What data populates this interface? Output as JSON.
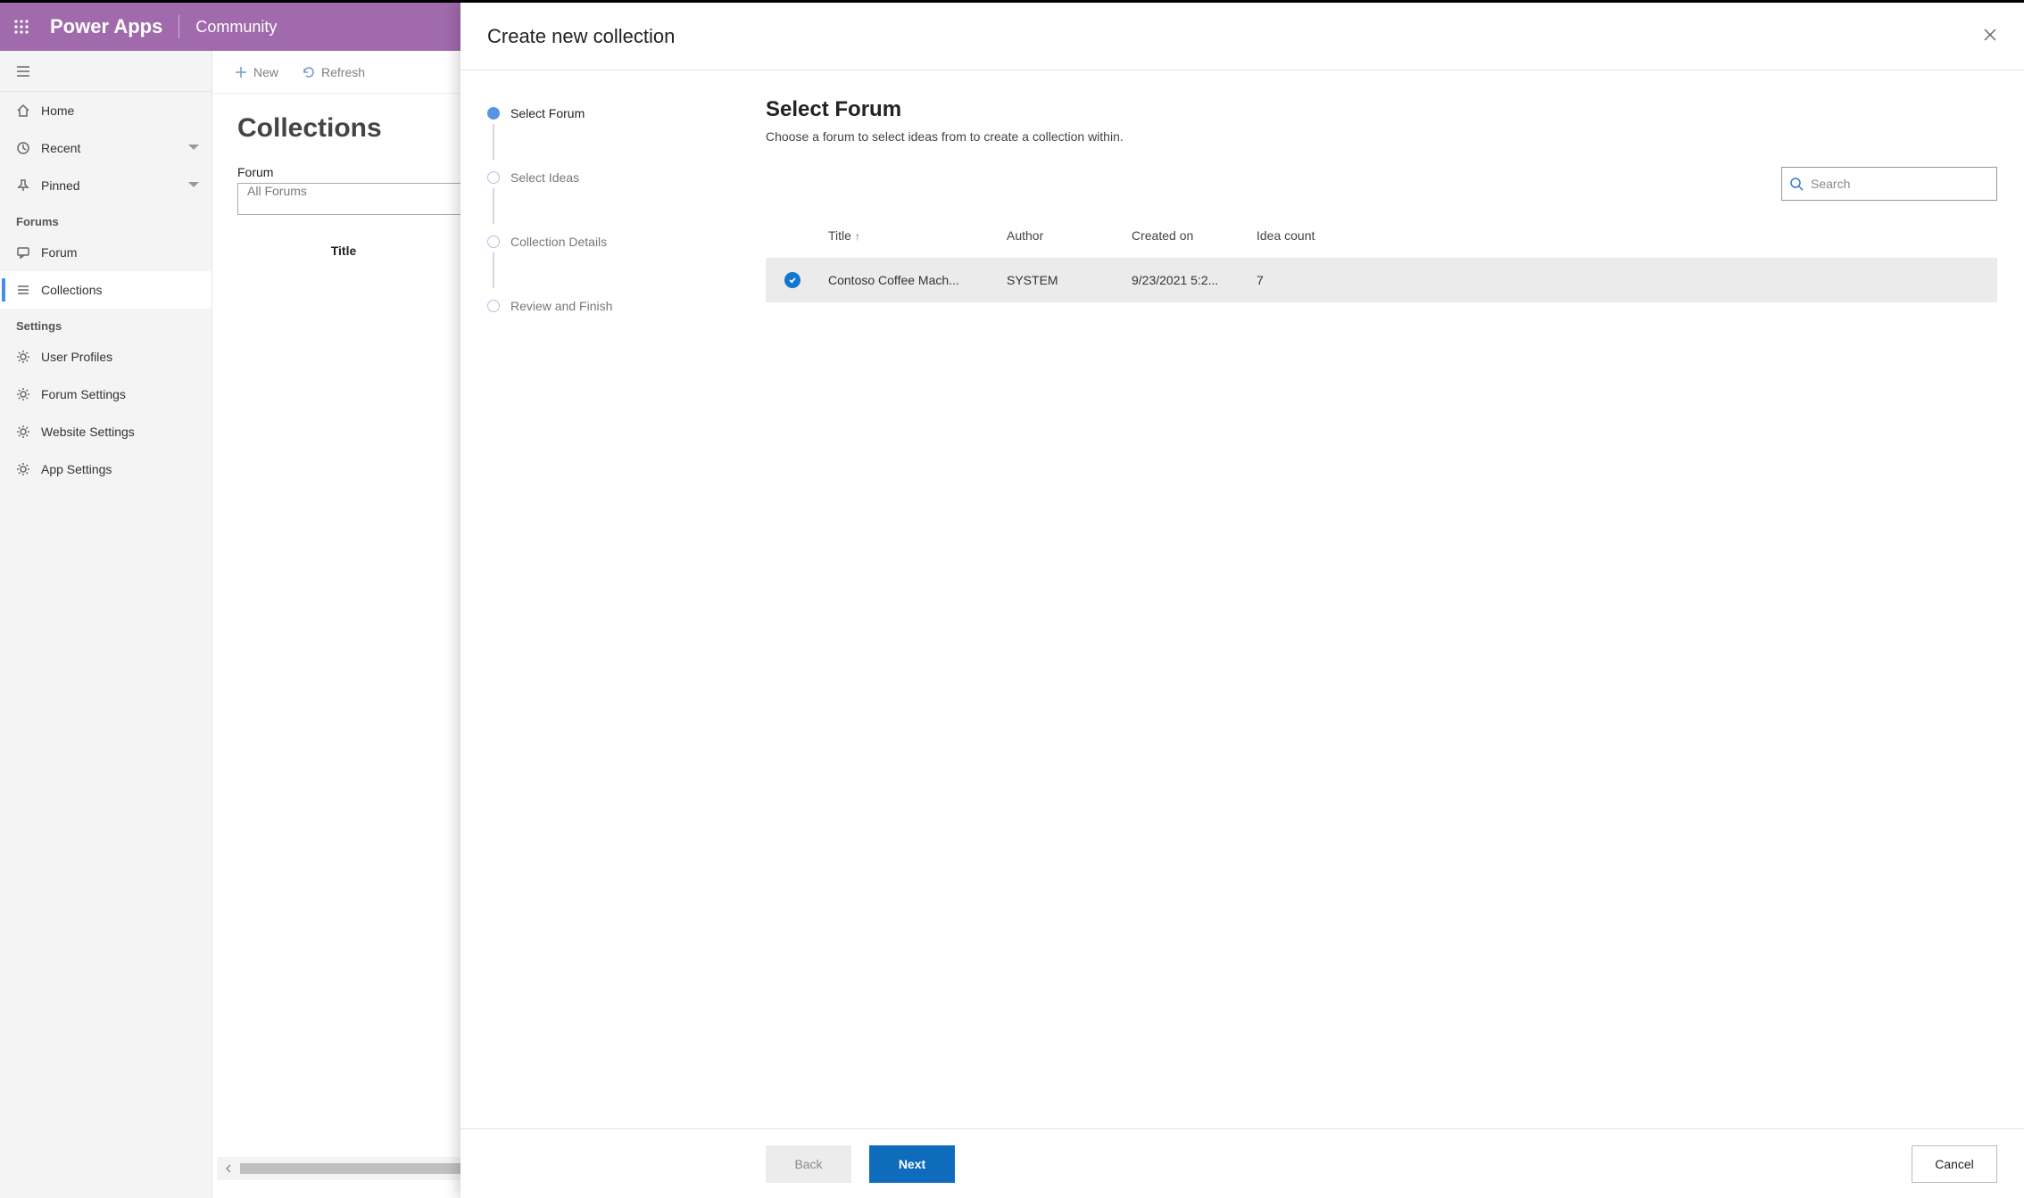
{
  "app": {
    "title": "Power Apps",
    "scope": "Community"
  },
  "leftnav": {
    "home": "Home",
    "recent": "Recent",
    "pinned": "Pinned",
    "section_forums": "Forums",
    "forum": "Forum",
    "collections": "Collections",
    "section_settings": "Settings",
    "user_profiles": "User Profiles",
    "forum_settings": "Forum Settings",
    "website_settings": "Website Settings",
    "app_settings": "App Settings"
  },
  "commands": {
    "new": "New",
    "refresh": "Refresh"
  },
  "listview": {
    "heading": "Collections",
    "forum_label": "Forum",
    "forum_value": "All Forums",
    "col_title": "Title"
  },
  "modal": {
    "title": "Create new collection",
    "steps": {
      "select_forum": "Select Forum",
      "select_ideas": "Select Ideas",
      "collection_details": "Collection Details",
      "review_finish": "Review and Finish"
    },
    "content": {
      "heading": "Select Forum",
      "subheading": "Choose a forum to select ideas from to create a collection within.",
      "search_placeholder": "Search"
    },
    "columns": {
      "title": "Title",
      "author": "Author",
      "created_on": "Created on",
      "idea_count": "Idea count"
    },
    "rows": [
      {
        "title": "Contoso Coffee Mach...",
        "author": "SYSTEM",
        "created_on": "9/23/2021 5:2...",
        "idea_count": "7",
        "selected": true
      }
    ],
    "footer": {
      "back": "Back",
      "next": "Next",
      "cancel": "Cancel"
    }
  }
}
